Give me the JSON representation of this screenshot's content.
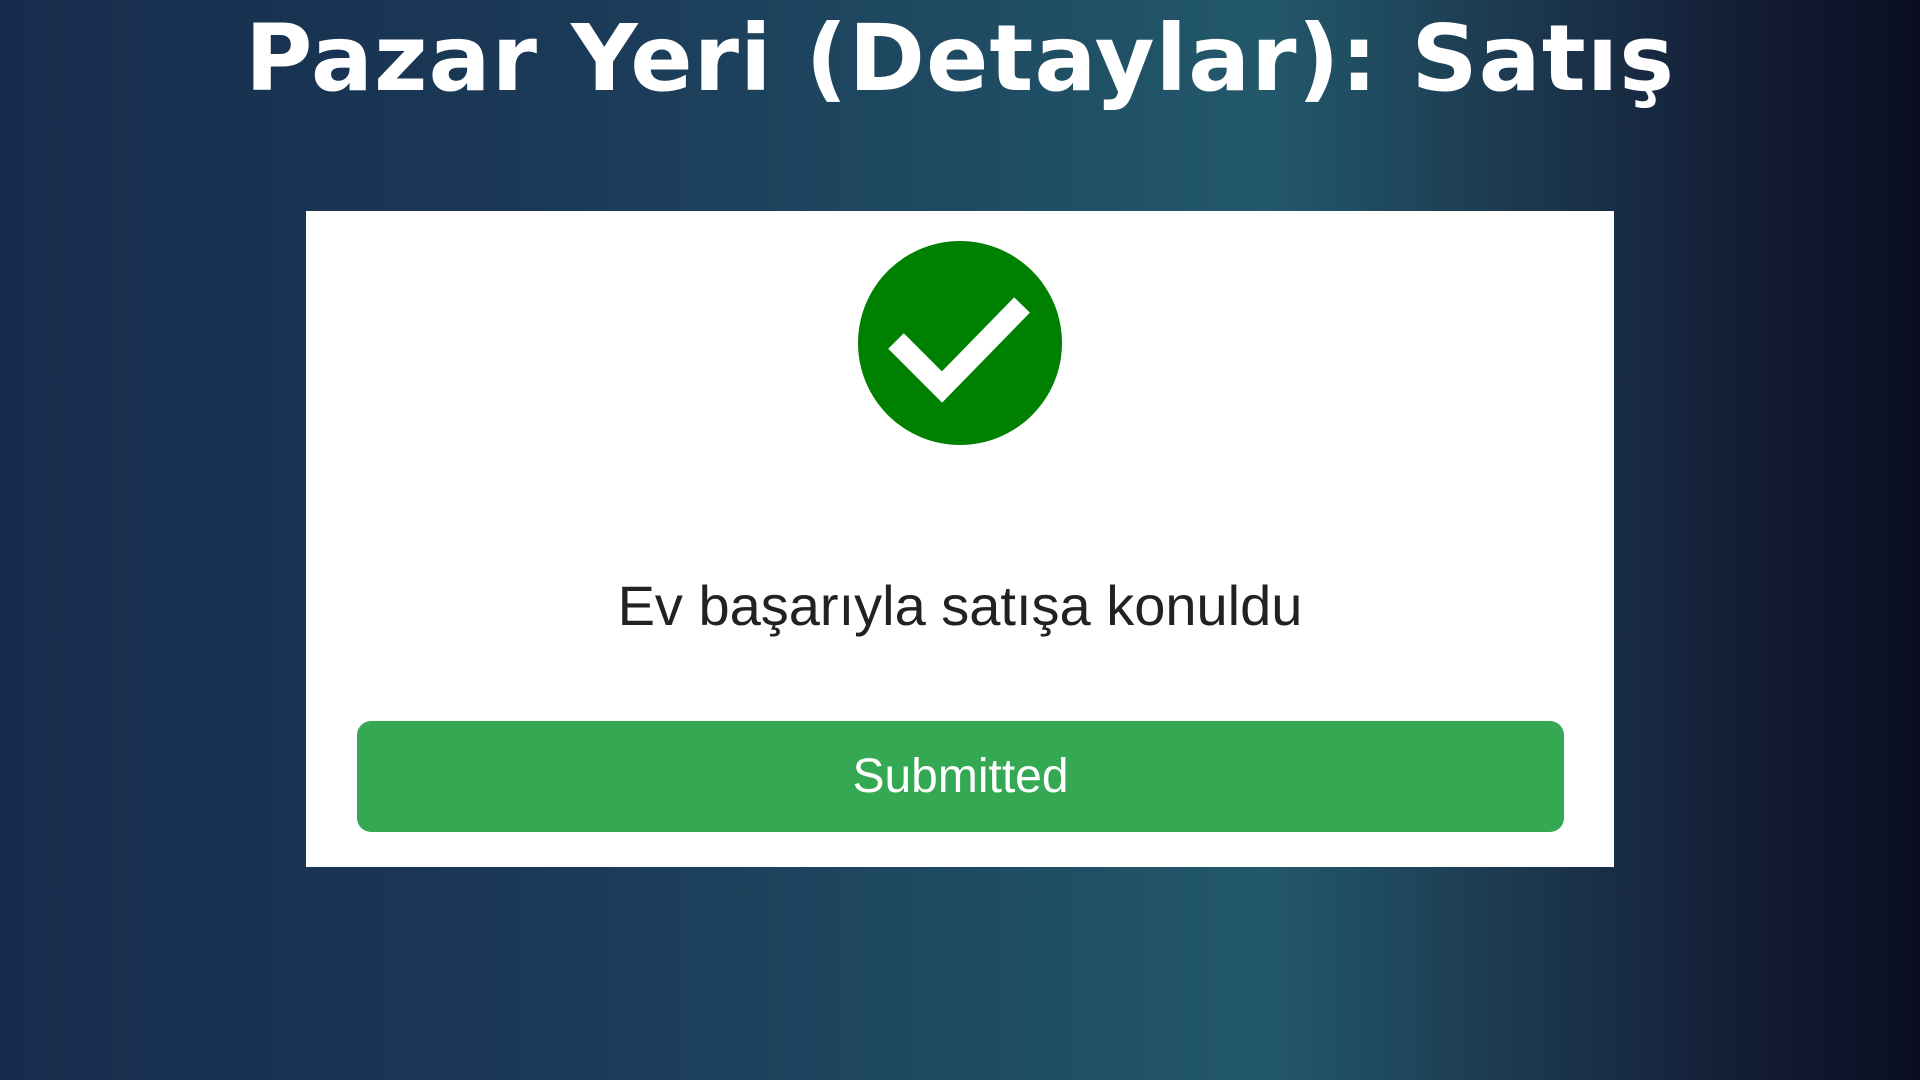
{
  "header": {
    "title": "Pazar Yeri (Detaylar): Satış"
  },
  "card": {
    "icon": "checkmark-circle-icon",
    "icon_color": "#008000",
    "message": "Ev başarıyla satışa konuldu",
    "button_label": "Submitted",
    "button_color": "#35a853"
  }
}
